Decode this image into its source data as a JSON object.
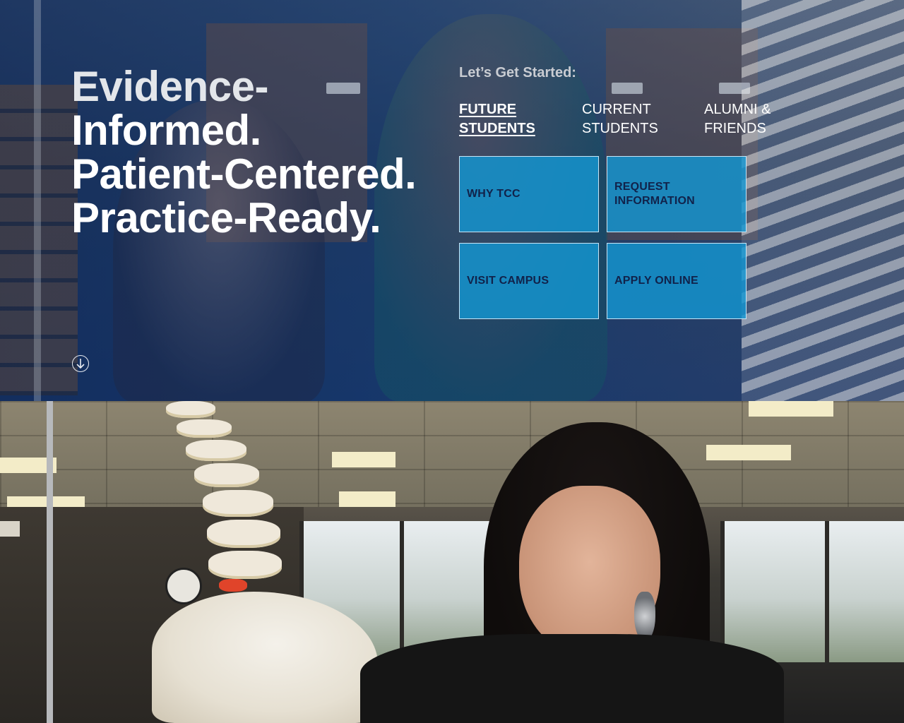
{
  "hero": {
    "headline": [
      "Evidence-",
      "Informed.",
      "Patient-Centered.",
      "Practice-Ready."
    ],
    "started_label": "Let’s Get Started:",
    "audience_tabs": [
      {
        "lines": [
          "FUTURE",
          "STUDENTS"
        ],
        "active": true
      },
      {
        "lines": [
          "CURRENT",
          "STUDENTS"
        ],
        "active": false
      },
      {
        "lines": [
          "ALUMNI &",
          "FRIENDS"
        ],
        "active": false
      }
    ],
    "tiles": [
      {
        "lines": [
          "WHY TCC"
        ]
      },
      {
        "lines": [
          "REQUEST",
          "INFORMATION"
        ]
      },
      {
        "lines": [
          "VISIT CAMPUS"
        ]
      },
      {
        "lines": [
          "APPLY ONLINE"
        ]
      }
    ],
    "scroll_icon": "arrow-down-circle-icon",
    "colors": {
      "tile_bg": "#1496d2",
      "tile_text": "#11224a",
      "overlay": "#0e2a5c"
    }
  },
  "photo_section": {
    "description_icon": "photo"
  }
}
